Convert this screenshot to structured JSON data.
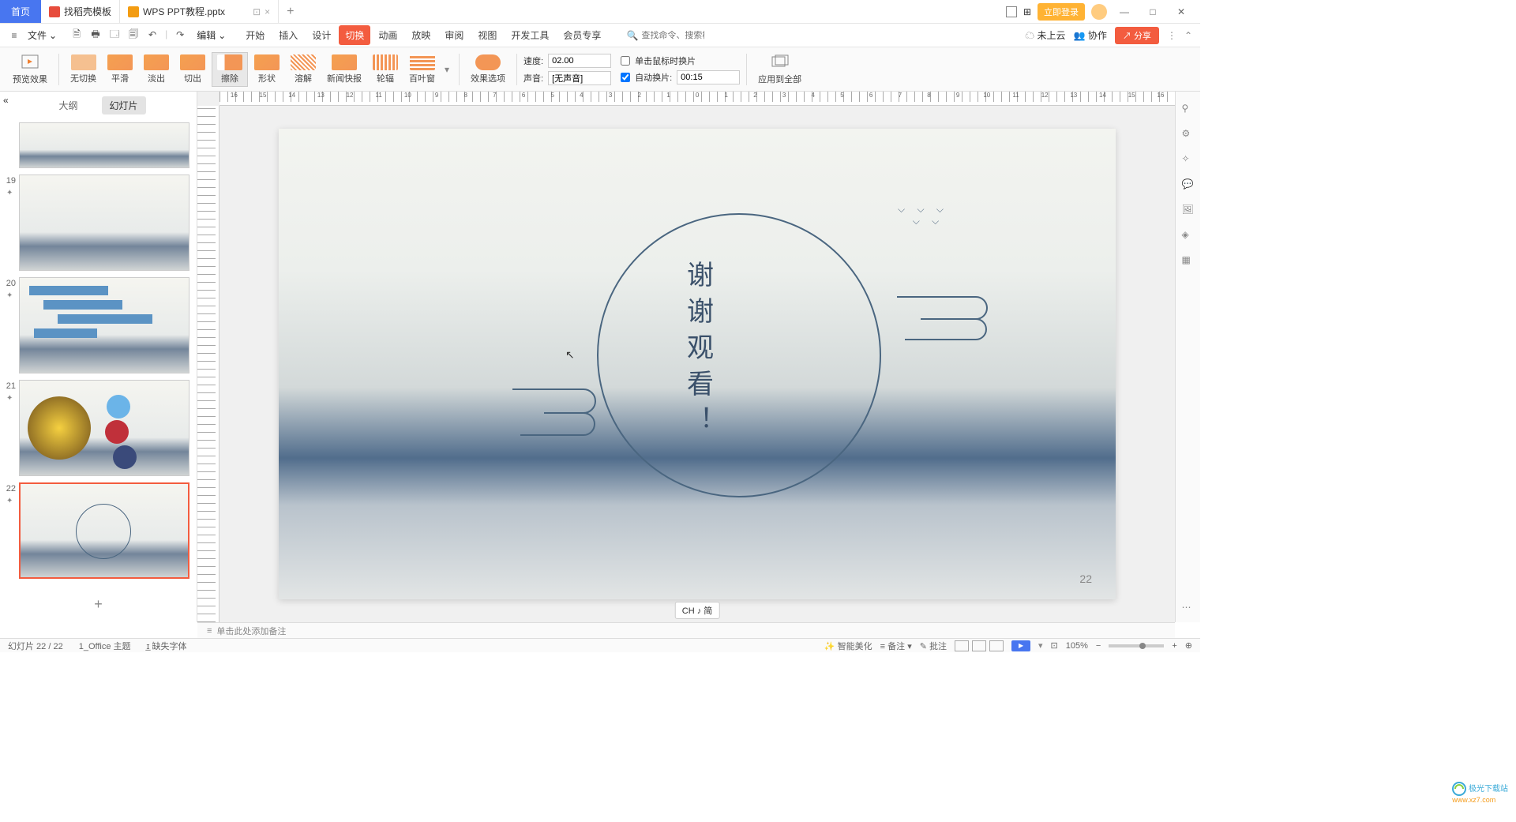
{
  "titlebar": {
    "home": "首页",
    "tab1": "找稻壳模板",
    "tab2": "WPS PPT教程.pptx",
    "login": "立即登录"
  },
  "menubar": {
    "file": "文件",
    "edit": "编辑",
    "tabs": {
      "start": "开始",
      "insert": "插入",
      "design": "设计",
      "transition": "切换",
      "animation": "动画",
      "play": "放映",
      "review": "审阅",
      "view": "视图",
      "dev": "开发工具",
      "member": "会员专享"
    },
    "search_hint": "查找命令、搜索模板",
    "cloud": "未上云",
    "collab": "协作",
    "share": "分享"
  },
  "ribbon": {
    "preview": "预览效果",
    "none": "无切换",
    "smooth": "平滑",
    "fadeout": "淡出",
    "cut": "切出",
    "erase": "擦除",
    "shape": "形状",
    "dissolve": "溶解",
    "news": "新闻快报",
    "comb": "轮辐",
    "blinds": "百叶窗",
    "effopt": "效果选项",
    "speed_lbl": "速度:",
    "speed_val": "02.00",
    "sound_lbl": "声音:",
    "sound_val": "[无声音]",
    "click_lbl": "单击鼠标时换片",
    "auto_lbl": "自动换片:",
    "auto_val": "00:15",
    "applyall": "应用到全部"
  },
  "sidebar": {
    "outline": "大纲",
    "slides": "幻灯片",
    "thumbs": [
      {
        "num": ""
      },
      {
        "num": "19"
      },
      {
        "num": "20"
      },
      {
        "num": "21"
      },
      {
        "num": "22"
      }
    ],
    "add": "+"
  },
  "ruler_h": [
    "16",
    "15",
    "14",
    "13",
    "12",
    "11",
    "10",
    "9",
    "8",
    "7",
    "6",
    "5",
    "4",
    "3",
    "2",
    "1",
    "0",
    "1",
    "2",
    "3",
    "4",
    "5",
    "6",
    "7",
    "8",
    "9",
    "10",
    "11",
    "12",
    "13",
    "14",
    "15",
    "16"
  ],
  "slide": {
    "text": "谢谢观看！",
    "pagenum": "22"
  },
  "ime": "CH ♪ 简",
  "notes": "单击此处添加备注",
  "statusbar": {
    "slide_idx": "幻灯片 22 / 22",
    "theme": "1_Office 主题",
    "missing_font": "缺失字体",
    "beautify": "智能美化",
    "notes_btn": "备注",
    "comments_btn": "批注",
    "zoom": "105%"
  },
  "watermark": {
    "name": "极光下载站",
    "url": "www.xz7.com"
  }
}
